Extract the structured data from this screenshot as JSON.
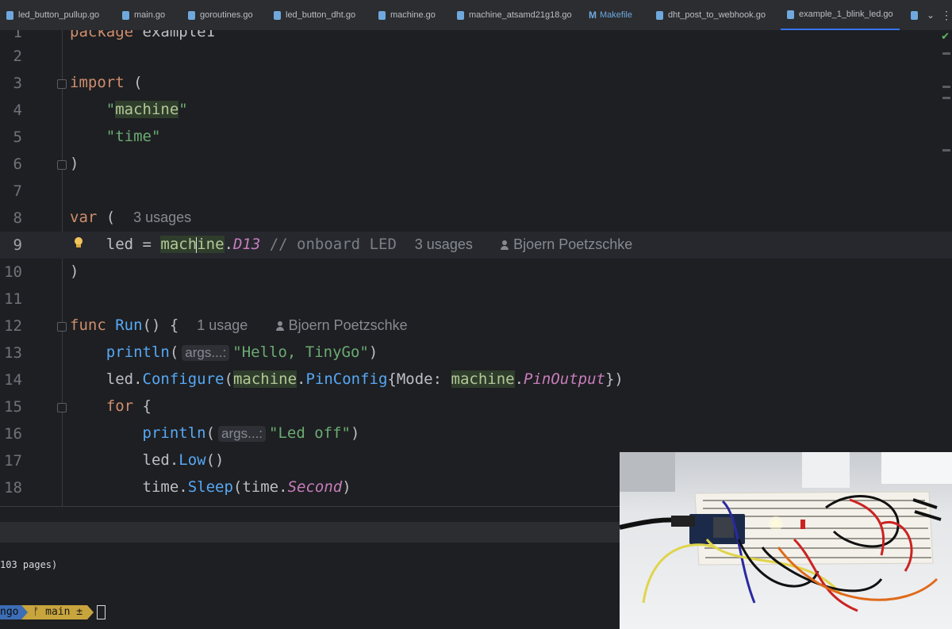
{
  "tabs": [
    {
      "label": "led_button_pullup.go",
      "icon": "go-file-icon",
      "active": false
    },
    {
      "label": "main.go",
      "icon": "go-file-icon",
      "active": false
    },
    {
      "label": "goroutines.go",
      "icon": "go-file-icon",
      "active": false
    },
    {
      "label": "led_button_dht.go",
      "icon": "go-file-icon",
      "active": false
    },
    {
      "label": "machine.go",
      "icon": "go-file-icon",
      "active": false
    },
    {
      "label": "machine_atsamd21g18.go",
      "icon": "go-file-icon",
      "active": false
    },
    {
      "label": "Makefile",
      "icon": "makefile-icon",
      "active": false
    },
    {
      "label": "dht_post_to_webhook.go",
      "icon": "go-file-icon",
      "active": false
    },
    {
      "label": "example_1_blink_led.go",
      "icon": "go-file-icon",
      "active": true
    }
  ],
  "editor": {
    "line_numbers": [
      "1",
      "2",
      "3",
      "4",
      "5",
      "6",
      "7",
      "8",
      "9",
      "10",
      "11",
      "12",
      "13",
      "14",
      "15",
      "16",
      "17",
      "18"
    ],
    "current_line": 9,
    "line1": {
      "kw": "package",
      "rest": " example1"
    },
    "line3": {
      "kw": "import",
      "rest": " ("
    },
    "line4": {
      "q1": "\"",
      "pkg": "machine",
      "q2": "\""
    },
    "line5": {
      "str": "\"time\""
    },
    "line6": {
      "text": ")"
    },
    "line8": {
      "kw": "var",
      "rest": " (",
      "hint": "3 usages"
    },
    "line9": {
      "ident": "led",
      "eq": " = ",
      "pkg_a": "mach",
      "pkg_b": "ine",
      "dot": ".",
      "const": "D13",
      "comment": " // onboard LED",
      "hint": "3 usages",
      "author": "Bjoern Poetzschke"
    },
    "line10": {
      "text": ")"
    },
    "line12": {
      "kw": "func",
      "name": " Run",
      "rest": "() {",
      "hint": "1 usage",
      "author": "Bjoern Poetzschke"
    },
    "line13": {
      "fn": "println",
      "open": "(",
      "inlay": "args...:",
      "str": "\"Hello, TinyGo\"",
      "close": ")"
    },
    "line14": {
      "ident": "led.",
      "fn": "Configure",
      "open": "(",
      "pkg": "machine",
      "dot": ".",
      "type": "PinConfig",
      "brace": "{Mode: ",
      "pkg2": "machine",
      "dot2": ".",
      "const": "PinOutput",
      "close": "})"
    },
    "line15": {
      "kw": "for",
      "rest": " {"
    },
    "line16": {
      "fn": "println",
      "open": "(",
      "inlay": "args...:",
      "str": "\"Led off\"",
      "close": ")"
    },
    "line17": {
      "ident": "led.",
      "fn": "Low",
      "rest": "()"
    },
    "line18": {
      "ident": "time.",
      "fn": "Sleep",
      "open": "(time.",
      "const": "Second",
      "close": ")"
    }
  },
  "terminal": {
    "output": "103 pages)",
    "prompt_dir": "ngo",
    "git_branch": "ᚠ main ±"
  },
  "colors": {
    "editor_bg": "#1e1f22",
    "keyword": "#cf8e6d",
    "string": "#6aab73",
    "function": "#56a8f5",
    "constant": "#c77dbb"
  }
}
